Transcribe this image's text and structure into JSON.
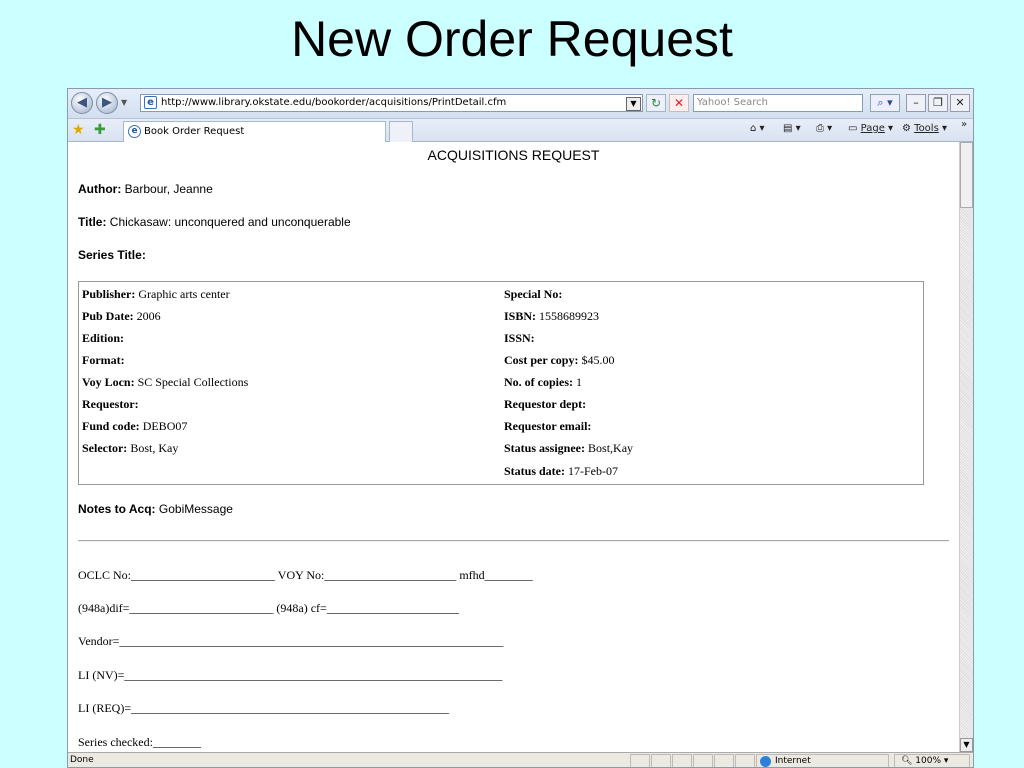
{
  "slide": {
    "title": "New Order Request"
  },
  "browser": {
    "url": "http://www.library.okstate.edu/bookorder/acquisitions/PrintDetail.cfm",
    "search_placeholder": "Yahoo! Search",
    "tab_label": "Book Order Request",
    "commands": {
      "page": "Page",
      "tools": "Tools"
    },
    "status": {
      "text": "Done",
      "zone": "Internet",
      "zoom": "100%"
    }
  },
  "request": {
    "heading": "ACQUISITIONS REQUEST",
    "author": {
      "label": "Author:",
      "value": "Barbour, Jeanne"
    },
    "title": {
      "label": "Title:",
      "value": "Chickasaw: unconquered and unconquerable"
    },
    "series_title": {
      "label": "Series Title:",
      "value": ""
    },
    "left_fields": [
      {
        "label": "Publisher:",
        "value": "Graphic arts center"
      },
      {
        "label": "Pub Date:",
        "value": "2006"
      },
      {
        "label": "Edition:",
        "value": ""
      },
      {
        "label": "Format:",
        "value": ""
      },
      {
        "label": "Voy Locn:",
        "value": "SC Special Collections"
      },
      {
        "label": "Requestor:",
        "value": ""
      },
      {
        "label": "Fund code:",
        "value": "DEBO07"
      },
      {
        "label": "Selector:",
        "value": "Bost, Kay"
      }
    ],
    "right_fields": [
      {
        "label": "Special No:",
        "value": ""
      },
      {
        "label": "ISBN:",
        "value": "1558689923"
      },
      {
        "label": "ISSN:",
        "value": ""
      },
      {
        "label": "Cost per copy:",
        "value": "$45.00"
      },
      {
        "label": "No. of copies:",
        "value": "1"
      },
      {
        "label": "Requestor dept:",
        "value": ""
      },
      {
        "label": "Requestor email:",
        "value": ""
      },
      {
        "label": "Status assignee:",
        "value": "Bost,Kay"
      },
      {
        "label": "Status date:",
        "value": "17-Feb-07"
      }
    ],
    "notes": {
      "label": "Notes to Acq:",
      "value": "GobiMessage"
    },
    "form_lines": [
      "OCLC No:________________________ VOY No:______________________ mfhd________",
      "(948a)dif=________________________ (948a) cf=______________________",
      "Vendor=________________________________________________________________",
      "LI (NV)=_______________________________________________________________",
      "LI (REQ)=_____________________________________________________",
      "Series checked:________"
    ]
  }
}
